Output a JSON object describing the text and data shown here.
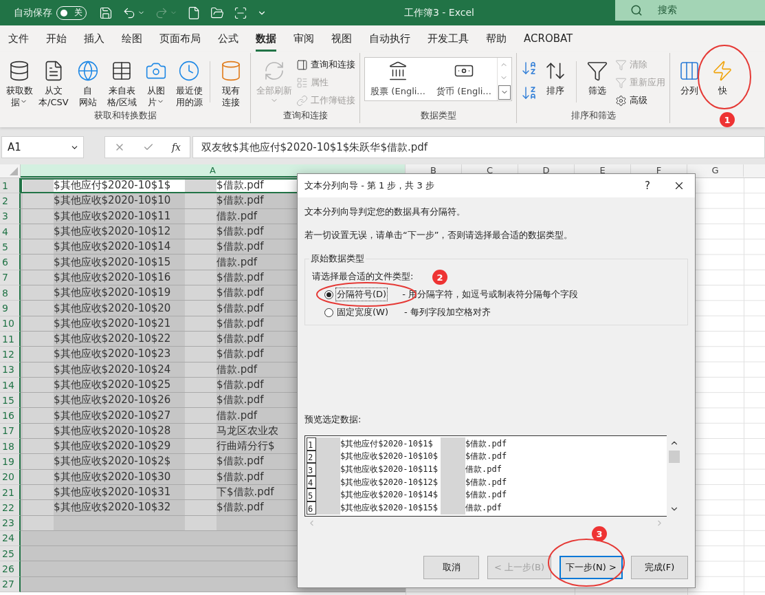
{
  "title_bar": {
    "autosave_label": "自动保存",
    "autosave": {
      "on": false,
      "label": "关"
    },
    "qat": [
      {
        "kind": "save",
        "disabled": false
      },
      {
        "kind": "undo",
        "disabled": false
      },
      {
        "kind": "redo",
        "disabled": true
      },
      {
        "kind": "new",
        "disabled": false
      },
      {
        "kind": "open",
        "disabled": false
      },
      {
        "kind": "scan",
        "disabled": false
      },
      {
        "kind": "customize",
        "disabled": false
      }
    ],
    "title": "工作簿3  -  Excel",
    "search": {
      "placeholder": "搜索"
    }
  },
  "tabs": [
    {
      "label": "文件",
      "selected": false
    },
    {
      "label": "开始",
      "selected": false
    },
    {
      "label": "插入",
      "selected": false
    },
    {
      "label": "绘图",
      "selected": false
    },
    {
      "label": "页面布局",
      "selected": false
    },
    {
      "label": "公式",
      "selected": false
    },
    {
      "label": "数据",
      "selected": true
    },
    {
      "label": "审阅",
      "selected": false
    },
    {
      "label": "视图",
      "selected": false
    },
    {
      "label": "自动执行",
      "selected": false
    },
    {
      "label": "开发工具",
      "selected": false
    },
    {
      "label": "帮助",
      "selected": false
    },
    {
      "label": "ACROBAT",
      "selected": false
    }
  ],
  "ribbon": {
    "groups": [
      {
        "label": "获取和转换数据",
        "items": [
          {
            "kind": "large",
            "lines": [
              "获取数",
              "据"
            ],
            "dropdown": true,
            "disabled": false
          },
          {
            "kind": "large",
            "lines": [
              "从文",
              "本/CSV"
            ],
            "dropdown": false,
            "disabled": false
          },
          {
            "kind": "large",
            "lines": [
              "自",
              "网站"
            ],
            "dropdown": false,
            "disabled": false
          },
          {
            "kind": "large",
            "lines": [
              "来自表",
              "格/区域"
            ],
            "dropdown": false,
            "disabled": false
          },
          {
            "kind": "large",
            "lines": [
              "从图",
              "片"
            ],
            "dropdown": true,
            "disabled": false
          },
          {
            "kind": "large",
            "lines": [
              "最近使",
              "用的源"
            ],
            "dropdown": false,
            "disabled": false
          },
          {
            "kind": "separator"
          },
          {
            "kind": "large",
            "lines": [
              "现有",
              "连接"
            ],
            "dropdown": false,
            "disabled": false
          }
        ]
      },
      {
        "label": "查询和连接",
        "items": [
          {
            "kind": "large",
            "lines": [
              "全部刷新"
            ],
            "dropdown": true,
            "disabled": true
          },
          {
            "kind": "stack",
            "items": [
              {
                "label": "查询和连接",
                "disabled": false
              },
              {
                "label": "属性",
                "disabled": true
              },
              {
                "label": "工作簿链接",
                "disabled": true
              }
            ]
          }
        ]
      },
      {
        "label": "数据类型",
        "items": [
          {
            "kind": "gallery",
            "items": [
              {
                "label": "股票 (Engli..."
              },
              {
                "label": "货币 (Engli..."
              }
            ]
          }
        ]
      },
      {
        "label": "排序和筛选",
        "items": [
          {
            "kind": "sort_pair"
          },
          {
            "kind": "large",
            "lines": [
              "排序"
            ],
            "dropdown": false,
            "disabled": false
          },
          {
            "kind": "separator"
          },
          {
            "kind": "large",
            "lines": [
              "筛选"
            ],
            "dropdown": false,
            "disabled": false
          },
          {
            "kind": "stack",
            "items": [
              {
                "label": "清除",
                "disabled": true
              },
              {
                "label": "重新应用",
                "disabled": true
              },
              {
                "label": "高级",
                "disabled": false
              }
            ]
          }
        ]
      },
      {
        "items": [
          {
            "kind": "large",
            "lines": [
              "分列"
            ],
            "dropdown": false,
            "disabled": false
          },
          {
            "kind": "large",
            "lines": [
              "快"
            ],
            "dropdown": false,
            "disabled": false
          }
        ]
      }
    ]
  },
  "formula_bar": {
    "name_box": "A1",
    "function_label": "fx",
    "formula": "双友牧$其他应付$2020-10$1$朱跃华$借款.pdf"
  },
  "sheet": {
    "columns": [
      {
        "label": "A",
        "selected": true
      },
      {
        "label": "B",
        "selected": false
      },
      {
        "label": "C",
        "selected": false
      },
      {
        "label": "D",
        "selected": false
      },
      {
        "label": "E",
        "selected": false
      },
      {
        "label": "F",
        "selected": false
      },
      {
        "label": "G",
        "selected": false
      }
    ],
    "rows": [
      {
        "number": "1",
        "active": true,
        "redacted": true,
        "part_1": "$其他应付$2020-10$1$",
        "part_2": "$借款.pdf"
      },
      {
        "number": "2",
        "active": false,
        "redacted": true,
        "part_1": "$其他应收$2020-10$10",
        "part_2": "$借款.pdf"
      },
      {
        "number": "3",
        "active": false,
        "redacted": true,
        "part_1": "$其他应收$2020-10$11",
        "part_2": "借款.pdf"
      },
      {
        "number": "4",
        "active": false,
        "redacted": true,
        "part_1": "$其他应收$2020-10$12",
        "part_2": "$借款.pdf"
      },
      {
        "number": "5",
        "active": false,
        "redacted": true,
        "part_1": "$其他应收$2020-10$14",
        "part_2": "$借款.pdf"
      },
      {
        "number": "6",
        "active": false,
        "redacted": true,
        "part_1": "$其他应收$2020-10$15",
        "part_2": "借款.pdf"
      },
      {
        "number": "7",
        "active": false,
        "redacted": true,
        "part_1": "$其他应收$2020-10$16",
        "part_2": "$借款.pdf"
      },
      {
        "number": "8",
        "active": false,
        "redacted": true,
        "part_1": "$其他应收$2020-10$19",
        "part_2": "$借款.pdf"
      },
      {
        "number": "9",
        "active": false,
        "redacted": true,
        "part_1": "$其他应收$2020-10$20",
        "part_2": "$借款.pdf"
      },
      {
        "number": "10",
        "active": false,
        "redacted": true,
        "part_1": "$其他应收$2020-10$21",
        "part_2": "$借款.pdf"
      },
      {
        "number": "11",
        "active": false,
        "redacted": true,
        "part_1": "$其他应收$2020-10$22",
        "part_2": "$借款.pdf"
      },
      {
        "number": "12",
        "active": false,
        "redacted": true,
        "part_1": "$其他应收$2020-10$23",
        "part_2": "$借款.pdf"
      },
      {
        "number": "13",
        "active": false,
        "redacted": true,
        "part_1": "$其他应收$2020-10$24",
        "part_2": "借款.pdf"
      },
      {
        "number": "14",
        "active": false,
        "redacted": true,
        "part_1": "$其他应收$2020-10$25",
        "part_2": "$借款.pdf"
      },
      {
        "number": "15",
        "active": false,
        "redacted": true,
        "part_1": "$其他应收$2020-10$26",
        "part_2": "$借款.pdf"
      },
      {
        "number": "16",
        "active": false,
        "redacted": true,
        "part_1": "$其他应收$2020-10$27",
        "part_2": "借款.pdf"
      },
      {
        "number": "17",
        "active": false,
        "redacted": true,
        "part_1": "$其他应收$2020-10$28",
        "part_2": "马龙区农业农"
      },
      {
        "number": "18",
        "active": false,
        "redacted": true,
        "part_1": "$其他应收$2020-10$29",
        "part_2": "行曲靖分行$"
      },
      {
        "number": "19",
        "active": false,
        "redacted": true,
        "part_1": "$其他应收$2020-10$2$",
        "part_2": "$借款.pdf"
      },
      {
        "number": "20",
        "active": false,
        "redacted": true,
        "part_1": "$其他应收$2020-10$30",
        "part_2": "$借款.pdf"
      },
      {
        "number": "21",
        "active": false,
        "redacted": true,
        "part_1": "$其他应收$2020-10$31",
        "part_2": "下$借款.pdf"
      },
      {
        "number": "22",
        "active": false,
        "redacted": true,
        "part_1": "$其他应收$2020-10$32",
        "part_2": "$借款.pdf"
      },
      {
        "number": "23",
        "active": false,
        "redacted": true
      },
      {
        "number": "24",
        "active": false,
        "redacted": false
      },
      {
        "number": "25",
        "active": false,
        "redacted": false
      },
      {
        "number": "26",
        "active": false,
        "redacted": false
      },
      {
        "number": "27",
        "active": false,
        "redacted": false
      }
    ]
  },
  "dialog": {
    "title": "文本分列向导 - 第 1 步，共 3 步",
    "help": "?",
    "intro": "文本分列向导判定您的数据具有分隔符。",
    "hint": "若一切设置无误，请单击“下一步”，否则请选择最合适的数据类型。",
    "group": {
      "title": "原始数据类型",
      "prompt": "请选择最合适的文件类型:",
      "options": [
        {
          "label": "分隔符号(D)",
          "description": "- 用分隔字符，如逗号或制表符分隔每个字段",
          "selected": true
        },
        {
          "label": "固定宽度(W)",
          "description": "- 每列字段加空格对齐",
          "selected": false
        }
      ]
    },
    "preview": {
      "label": "预览选定数据:",
      "rows": [
        {
          "number": "1",
          "part_1": "$其他应付$2020-10$1$",
          "part_2": "$借款.pdf"
        },
        {
          "number": "2",
          "part_1": "$其他应收$2020-10$10$",
          "part_2": "$借款.pdf"
        },
        {
          "number": "3",
          "part_1": "$其他应收$2020-10$11$",
          "part_2": "借款.pdf"
        },
        {
          "number": "4",
          "part_1": "$其他应收$2020-10$12$",
          "part_2": "$借款.pdf"
        },
        {
          "number": "5",
          "part_1": "$其他应收$2020-10$14$",
          "part_2": "$借款.pdf"
        },
        {
          "number": "6",
          "part_1": "$其他应收$2020-10$15$",
          "part_2": "借款.pdf"
        }
      ]
    },
    "buttons": [
      {
        "label": "取消",
        "disabled": false,
        "focused": false
      },
      {
        "label": "< 上一步(B)",
        "disabled": true,
        "focused": false
      },
      {
        "label": "下一步(N)  >",
        "disabled": false,
        "focused": true
      },
      {
        "label": "完成(F)",
        "disabled": false,
        "focused": false
      }
    ]
  },
  "annotations": [
    {
      "number": "1"
    },
    {
      "number": "2"
    },
    {
      "number": "3"
    }
  ]
}
